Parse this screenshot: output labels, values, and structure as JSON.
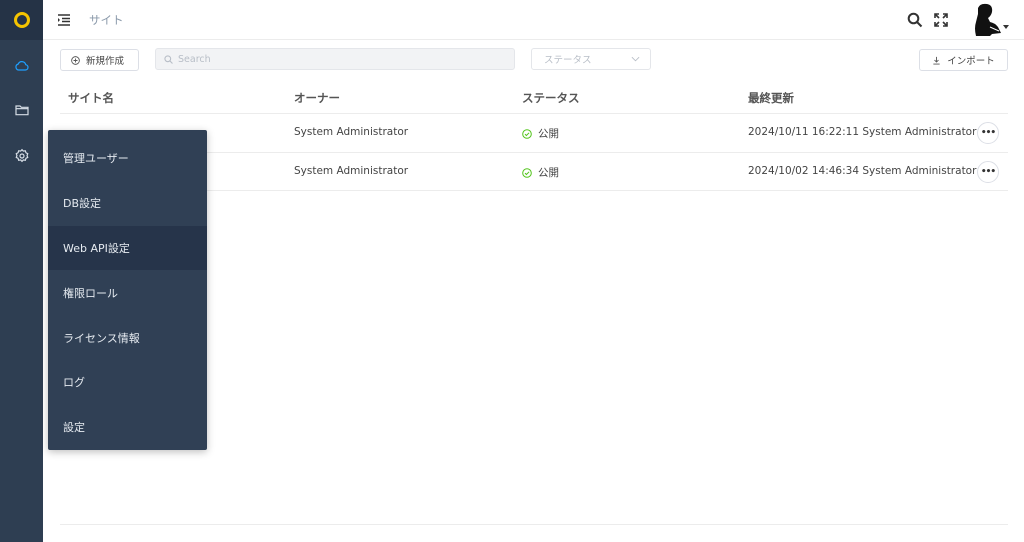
{
  "topbar": {
    "page_title": "サイト"
  },
  "toolbar": {
    "new_label": "新規作成",
    "search_placeholder": "Search",
    "status_placeholder": "ステータス",
    "import_label": "インポート"
  },
  "table": {
    "headers": [
      "サイト名",
      "オーナー",
      "ステータス",
      "最終更新"
    ],
    "rows": [
      {
        "owner": "System Administrator",
        "status": "公開",
        "updated": "2024/10/11 16:22:11 System Administrator"
      },
      {
        "owner": "System Administrator",
        "status": "公開",
        "updated": "2024/10/02 14:46:34 System Administrator"
      }
    ]
  },
  "flyout": {
    "items": [
      {
        "label": "管理ユーザー"
      },
      {
        "label": "DB設定"
      },
      {
        "label": "Web API設定"
      },
      {
        "label": "権限ロール"
      },
      {
        "label": "ライセンス情報"
      },
      {
        "label": "ログ"
      },
      {
        "label": "設定"
      }
    ],
    "active_index": 2
  },
  "icons": {
    "rail": [
      "logo-ring-icon",
      "cloud-icon",
      "folder-icon",
      "gear-icon"
    ],
    "top": [
      "menu-indent-icon",
      "search-icon",
      "fullscreen-icon",
      "avatar"
    ]
  },
  "colors": {
    "rail_bg": "#2e3e52",
    "logo_accent": "#f5c400",
    "status_ok": "#52c41a",
    "cloud_active": "#1e9fff"
  }
}
